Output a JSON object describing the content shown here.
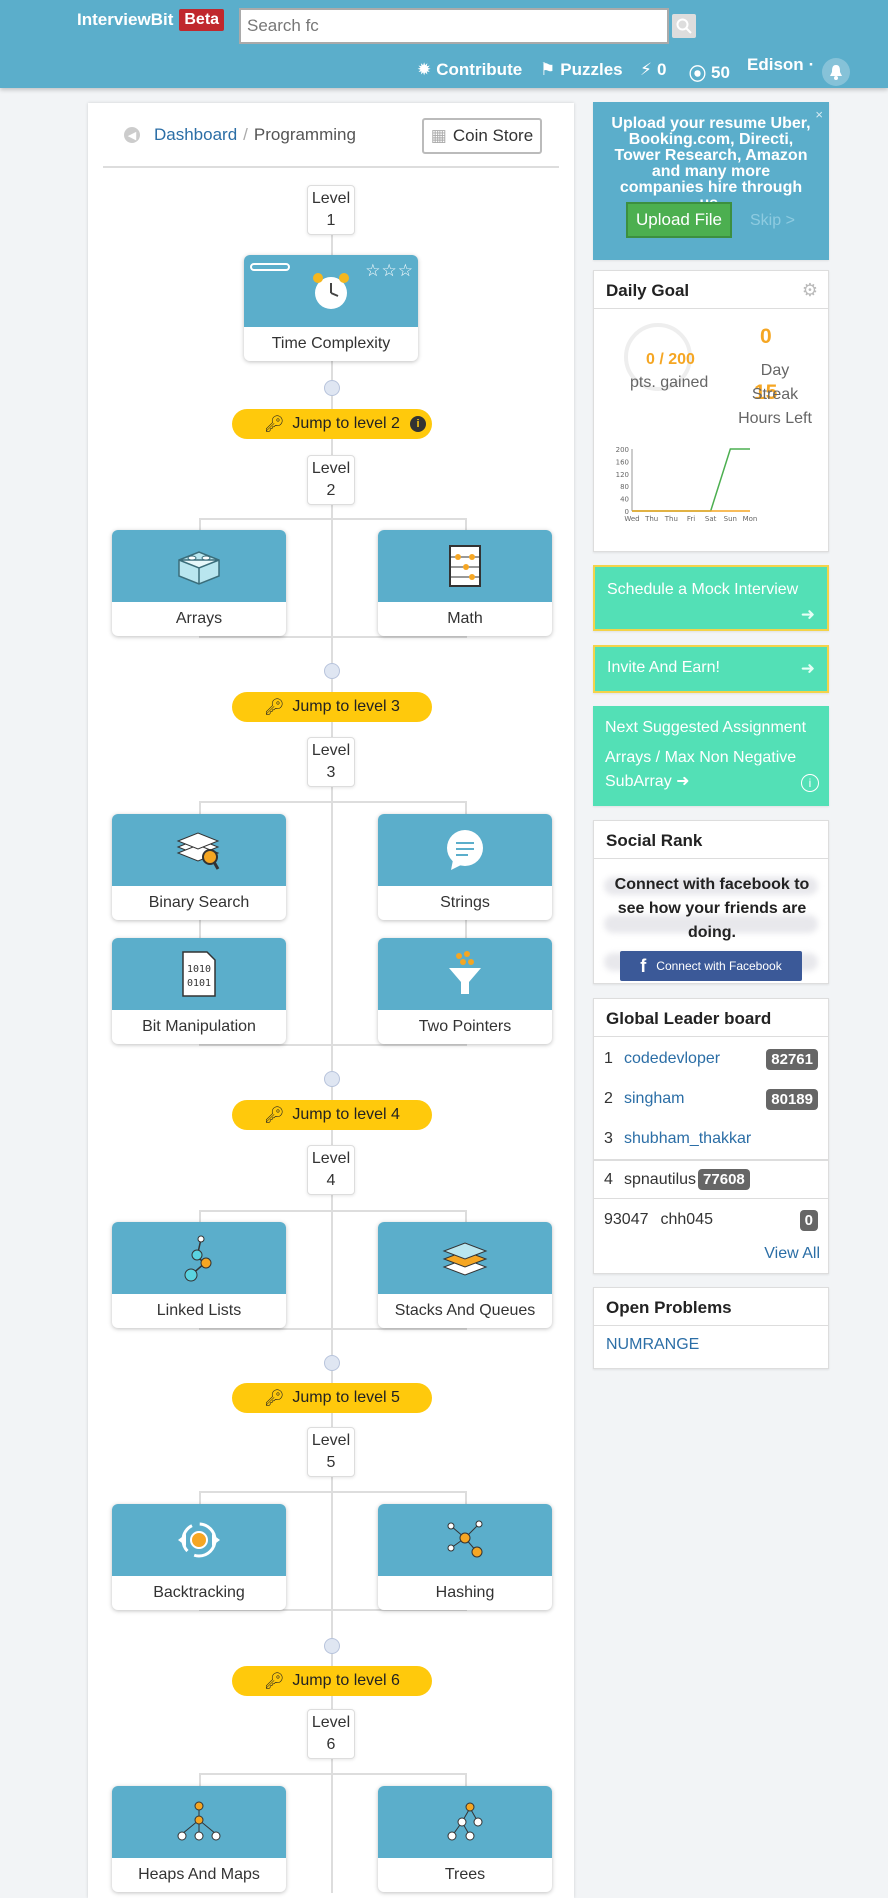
{
  "header": {
    "logo": "InterviewBit",
    "beta": "Beta",
    "search_value": "Search fc",
    "contribute": "Contribute",
    "puzzles": "Puzzles",
    "bolts": "0",
    "coins": "50",
    "user": "Edison",
    "user_caret": "·"
  },
  "breadcrumb": {
    "dashboard": "Dashboard",
    "sep": "/",
    "current": "Programming"
  },
  "coin_store": "Coin Store",
  "level_word": "Level",
  "levels": [
    "1",
    "2",
    "3",
    "4",
    "5",
    "6"
  ],
  "jumps": [
    "Jump to level 2",
    "Jump to level 3",
    "Jump to level 4",
    "Jump to level 5",
    "Jump to level 6"
  ],
  "topics": {
    "time_complexity": "Time Complexity",
    "arrays": "Arrays",
    "math": "Math",
    "binary_search": "Binary Search",
    "strings": "Strings",
    "bit_manipulation": "Bit Manipulation",
    "two_pointers": "Two Pointers",
    "linked_lists": "Linked Lists",
    "stacks_queues": "Stacks And Queues",
    "backtracking": "Backtracking",
    "hashing": "Hashing",
    "heaps_maps": "Heaps And Maps",
    "trees": "Trees"
  },
  "stars": "☆☆☆",
  "upload": {
    "text": "Upload your resume Uber, Booking.com, Directi, Tower Research, Amazon and many more companies hire through us.",
    "button": "Upload File",
    "skip": "Skip >",
    "close": "×"
  },
  "daily_goal": {
    "title": "Daily Goal",
    "points": "0 / 200",
    "points_label": "pts. gained",
    "streak": "0",
    "streak_label": "Day Streak",
    "hours": "15",
    "hours_label": "Hours Left",
    "chart_yticks": [
      "200",
      "160",
      "120",
      "80",
      "40",
      "0"
    ],
    "chart_days": [
      "Wed",
      "Thu",
      "Thu",
      "Fri",
      "Sat",
      "Sun",
      "Mon"
    ]
  },
  "chart_data": {
    "type": "line",
    "categories": [
      "Wed",
      "Thu",
      "Thu",
      "Fri",
      "Sat",
      "Sun",
      "Mon"
    ],
    "series": [
      {
        "values": [
          0,
          0,
          0,
          0,
          0,
          200,
          200
        ]
      },
      {
        "values": [
          0,
          0,
          0,
          0,
          0,
          0,
          0
        ]
      }
    ],
    "ylim": [
      0,
      200
    ]
  },
  "mock": "Schedule a Mock Interview",
  "invite": "Invite And Earn!",
  "next": {
    "title": "Next Suggested Assignment",
    "assignment": "Arrays / Max Non Negative SubArray"
  },
  "social": {
    "title": "Social Rank",
    "message": "Connect with facebook to see how your friends are doing.",
    "button": "Connect with Facebook"
  },
  "leaderboard": {
    "title": "Global Leader board",
    "rows": [
      {
        "rank": "1",
        "name": "codedevloper",
        "score": "82761"
      },
      {
        "rank": "2",
        "name": "singham",
        "score": "80189"
      },
      {
        "rank": "3",
        "name": "shubham_thakkar",
        "score": ""
      },
      {
        "rank": "4",
        "name": "spnautilus",
        "score": "77608"
      }
    ],
    "me": {
      "rank": "93047",
      "name": "chh045",
      "score": "0"
    },
    "view_all": "View All"
  },
  "open_problems": {
    "title": "Open Problems",
    "items": [
      "NUMRANGE"
    ]
  }
}
